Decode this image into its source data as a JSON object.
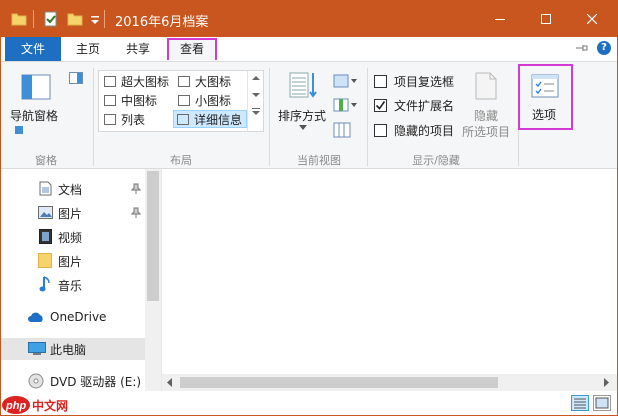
{
  "window": {
    "title": "2016年6月档案",
    "controls": {
      "minimize": "minimize",
      "maximize": "maximize",
      "close": "close"
    }
  },
  "tabs": {
    "file": "文件",
    "home": "主页",
    "share": "共享",
    "view": "查看"
  },
  "ribbon": {
    "panes": {
      "nav_pane_label": "导航窗格",
      "group_label": "窗格"
    },
    "layout": {
      "items": [
        "超大图标",
        "大图标",
        "中图标",
        "小图标",
        "列表",
        "详细信息"
      ],
      "selected": "详细信息",
      "group_label": "布局"
    },
    "current_view": {
      "sort_label": "排序方式",
      "group_label": "当前视图"
    },
    "show_hide": {
      "item_checkboxes": {
        "label": "项目复选框",
        "checked": false
      },
      "file_extensions": {
        "label": "文件扩展名",
        "checked": true
      },
      "hidden_items": {
        "label": "隐藏的项目",
        "checked": false
      },
      "hide_selected_line1": "隐藏",
      "hide_selected_line2": "所选项目",
      "group_label": "显示/隐藏"
    },
    "options_label": "选项"
  },
  "nav": {
    "items": [
      {
        "label": "文档",
        "icon": "document-icon",
        "pinned": true
      },
      {
        "label": "图片",
        "icon": "picture-icon",
        "pinned": true
      },
      {
        "label": "视频",
        "icon": "video-icon",
        "pinned": false
      },
      {
        "label": "图片",
        "icon": "folder-icon",
        "pinned": false
      },
      {
        "label": "音乐",
        "icon": "music-icon",
        "pinned": false
      },
      {
        "label": "OneDrive",
        "icon": "onedrive-icon",
        "pinned": false
      },
      {
        "label": "此电脑",
        "icon": "computer-icon",
        "pinned": false,
        "selected": true
      },
      {
        "label": "DVD 驱动器 (E:) ",
        "icon": "dvd-icon",
        "pinned": false
      }
    ]
  },
  "watermark": "php中文网",
  "colors": {
    "title_bar": "#c8561e",
    "file_tab": "#1e6fc2",
    "highlight": "#d23ad2",
    "selection": "#cde8ff"
  }
}
